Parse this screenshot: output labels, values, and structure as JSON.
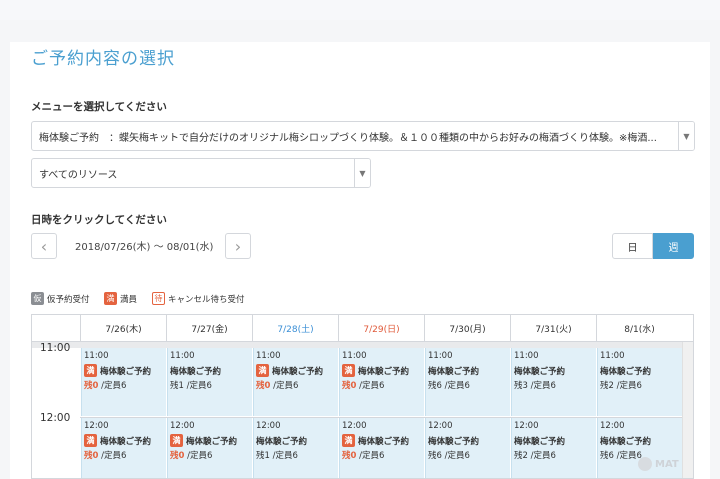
{
  "title": "ご予約内容の選択",
  "menu_label": "メニューを選択してください",
  "menu_select": "梅体験ご予約　：蝶矢梅キットで自分だけのオリジナル梅シロップづくり体験。＆１００種類の中からお好みの梅酒づくり体験。※梅酒...",
  "resource_select": "すべてのリソース",
  "datetime_label": "日時をクリックしてください",
  "nav": {
    "prev": "‹",
    "next": "›",
    "range": "2018/07/26(木) 〜 08/01(水)"
  },
  "view_toggle": {
    "day": "日",
    "week": "週"
  },
  "legend": {
    "kari_badge": "仮",
    "kari": "仮予約受付",
    "man_badge": "満",
    "man": "満員",
    "machi_badge": "待",
    "machi": "キャンセル待ち受付"
  },
  "days": [
    "7/26(木)",
    "7/27(金)",
    "7/28(土)",
    "7/29(日)",
    "7/30(月)",
    "7/31(火)",
    "8/1(水)"
  ],
  "times": [
    "11:00",
    "12:00"
  ],
  "slot_name": "梅体験ご予約",
  "full_badge": "満",
  "slots_11": [
    {
      "time": "11:00",
      "full": true,
      "rem": "残0",
      "cap": "/定員6"
    },
    {
      "time": "11:00",
      "full": false,
      "rem": "残1",
      "cap": "/定員6"
    },
    {
      "time": "11:00",
      "full": true,
      "rem": "残0",
      "cap": "/定員6"
    },
    {
      "time": "11:00",
      "full": true,
      "rem": "残0",
      "cap": "/定員6"
    },
    {
      "time": "11:00",
      "full": false,
      "rem": "残6",
      "cap": "/定員6"
    },
    {
      "time": "11:00",
      "full": false,
      "rem": "残3",
      "cap": "/定員6"
    },
    {
      "time": "11:00",
      "full": false,
      "rem": "残2",
      "cap": "/定員6"
    }
  ],
  "slots_12": [
    {
      "time": "12:00",
      "full": true,
      "rem": "残0",
      "cap": "/定員6"
    },
    {
      "time": "12:00",
      "full": true,
      "rem": "残0",
      "cap": "/定員6"
    },
    {
      "time": "12:00",
      "full": false,
      "rem": "残1",
      "cap": "/定員6"
    },
    {
      "time": "12:00",
      "full": true,
      "rem": "残0",
      "cap": "/定員6"
    },
    {
      "time": "12:00",
      "full": false,
      "rem": "残6",
      "cap": "/定員6"
    },
    {
      "time": "12:00",
      "full": false,
      "rem": "残2",
      "cap": "/定員6"
    },
    {
      "time": "12:00",
      "full": false,
      "rem": "残6",
      "cap": "/定員6"
    }
  ],
  "watermark": "MAT"
}
